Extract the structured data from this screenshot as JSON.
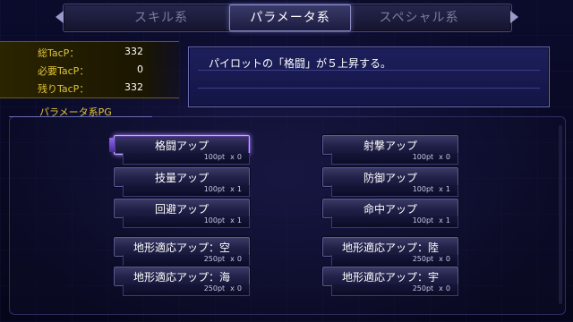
{
  "tabs": {
    "left": "スキル系",
    "active": "パラメータ系",
    "right": "スペシャル系"
  },
  "stats": [
    {
      "label": "総TacP：",
      "value": "332"
    },
    {
      "label": "必要TacP：",
      "value": "0"
    },
    {
      "label": "残りTacP：",
      "value": "332"
    }
  ],
  "message": "パイロットの「格闘」が５上昇する。",
  "section_label": "パラメータ系PG",
  "buttons": [
    {
      "label": "格闘アップ",
      "cost": "100pt",
      "x": "x",
      "count": "0",
      "selected": true
    },
    {
      "label": "射撃アップ",
      "cost": "100pt",
      "x": "x",
      "count": "0",
      "selected": false
    },
    {
      "label": "技量アップ",
      "cost": "100pt",
      "x": "x",
      "count": "1",
      "selected": false
    },
    {
      "label": "防御アップ",
      "cost": "100pt",
      "x": "x",
      "count": "1",
      "selected": false
    },
    {
      "label": "回避アップ",
      "cost": "100pt",
      "x": "x",
      "count": "1",
      "selected": false
    },
    {
      "label": "命中アップ",
      "cost": "100pt",
      "x": "x",
      "count": "1",
      "selected": false
    },
    {
      "label": "地形適応アップ：空",
      "cost": "250pt",
      "x": "x",
      "count": "0",
      "selected": false
    },
    {
      "label": "地形適応アップ：陸",
      "cost": "250pt",
      "x": "x",
      "count": "0",
      "selected": false
    },
    {
      "label": "地形適応アップ：海",
      "cost": "250pt",
      "x": "x",
      "count": "0",
      "selected": false
    },
    {
      "label": "地形適応アップ：宇",
      "cost": "250pt",
      "x": "x",
      "count": "0",
      "selected": false
    }
  ],
  "colors": {
    "accent_gold": "#e0c33a",
    "selection_glow": "#b28cff",
    "panel_blue": "#1d1f5c"
  }
}
